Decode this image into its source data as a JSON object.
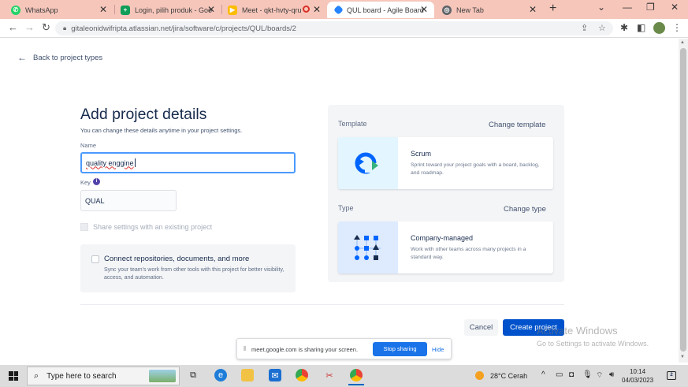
{
  "browser": {
    "tabs": [
      {
        "title": "WhatsApp",
        "icon": "whatsapp-icon",
        "color": "#25d366"
      },
      {
        "title": "Login, pilih produk - Goo",
        "icon": "sheets-icon",
        "color": "#0f9d58"
      },
      {
        "title": "Meet - qkt-hvty-qru",
        "icon": "meet-icon",
        "color": "#00897b"
      },
      {
        "title": "QUL board - Agile Board",
        "icon": "jira-icon",
        "color": "#2684ff"
      },
      {
        "title": "New Tab",
        "icon": "chrome-icon",
        "color": "#5f6368"
      }
    ],
    "url": "gitaleonidwifripta.atlassian.net/jira/software/c/projects/QUL/boards/2"
  },
  "page": {
    "back_label": "Back to project types",
    "title": "Add project details",
    "subtitle": "You can change these details anytime in your project settings.",
    "name_label": "Name",
    "name_value": "quality enggine",
    "key_label": "Key",
    "key_value": "QUAL",
    "share_label": "Share settings with an existing project",
    "connect_title": "Connect repositories, documents, and more",
    "connect_desc": "Sync your team's work from other tools with this project for better visibility, access, and automation.",
    "template_label": "Template",
    "change_template": "Change template",
    "template_name": "Scrum",
    "template_desc": "Sprint toward your project goals with a board, backlog, and roadmap.",
    "type_label": "Type",
    "change_type": "Change type",
    "type_name": "Company-managed",
    "type_desc": "Work with other teams across many projects in a standard way.",
    "cancel": "Cancel",
    "create": "Create project"
  },
  "screen_share": {
    "message": "meet.google.com is sharing your screen.",
    "stop": "Stop sharing",
    "hide": "Hide"
  },
  "watermark": {
    "line1": "Activate Windows",
    "line2": "Go to Settings to activate Windows."
  },
  "taskbar": {
    "search_placeholder": "Type here to search",
    "weather": "28°C  Cerah",
    "time": "10:14",
    "date": "04/03/2023",
    "notification_count": "2"
  },
  "colors": {
    "accent": "#0052cc",
    "focus": "#4c9aff",
    "tabstrip": "#f6c6bb"
  }
}
